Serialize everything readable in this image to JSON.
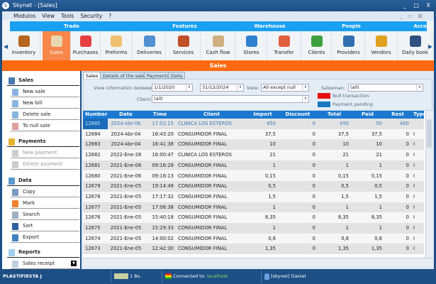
{
  "window": {
    "title": "Skynet - [Sales]"
  },
  "menu": [
    "Modulos",
    "View",
    "Tools",
    "Security",
    "?"
  ],
  "ribbon": {
    "groups": [
      "Trade",
      "Features",
      "Warehouse",
      "People",
      "Acco"
    ],
    "items": [
      {
        "label": "Inventory",
        "color": "#b5651d"
      },
      {
        "label": "Sales",
        "color": "#e8d7b0"
      },
      {
        "label": "Purchases",
        "color": "#e84040"
      },
      {
        "label": "Preforms",
        "color": "#f0c070"
      },
      {
        "label": "Deliveries",
        "color": "#5090d0"
      },
      {
        "label": "Services",
        "color": "#c0502a"
      },
      {
        "label": "Cash flow",
        "color": "#d0b080"
      },
      {
        "label": "Stores",
        "color": "#3080d0"
      },
      {
        "label": "Transfer",
        "color": "#e06040"
      },
      {
        "label": "Clients",
        "color": "#40a040"
      },
      {
        "label": "Providers",
        "color": "#3070b0"
      },
      {
        "label": "Vendors",
        "color": "#e0a020"
      },
      {
        "label": "Daily book",
        "color": "#305080"
      }
    ],
    "active": "Sales"
  },
  "section_title": "Sales",
  "left_panel": {
    "sales": {
      "title": "Sales",
      "items": [
        "New sale",
        "New bill",
        "Delete sale",
        "To null sale"
      ]
    },
    "payments": {
      "title": "Payments",
      "items": [
        "New payment",
        "Delete payment"
      ]
    },
    "data": {
      "title": "Data",
      "items": [
        "Copy",
        "Mark",
        "Search",
        "Sort",
        "Export"
      ]
    },
    "reports": {
      "title": "Reports",
      "items": [
        "Sales receipt"
      ]
    }
  },
  "tabs": [
    "Sales",
    "Details of the sale",
    "Payments",
    "Daily"
  ],
  "filters": {
    "between_label": "View information between:",
    "date_from": "1/1/2020",
    "date_to": "31/12/2024",
    "view_label": "View:",
    "view_value": "All except null",
    "salesman_label": "Salesman:",
    "salesman_value": "(all)",
    "client_label": "Client:",
    "client_value": "(all)"
  },
  "legend": [
    {
      "label": "Null transaction",
      "color": "#e81010"
    },
    {
      "label": "Payment pending",
      "color": "#1a78c0"
    }
  ],
  "table": {
    "columns": [
      "Number",
      "Date",
      "Time",
      "Client",
      "Import",
      "Discount",
      "Total",
      "Paid",
      "Rest",
      "Type"
    ],
    "rows": [
      [
        "12685",
        "2024-Abr-06",
        "17:02:15",
        "CLINICA LOS ESTEROS",
        "450",
        "0",
        "450",
        "50",
        "400",
        ""
      ],
      [
        "12684",
        "2024-Abr-04",
        "16:43:20",
        "CONSUMIDOR FINAL",
        "37,5",
        "0",
        "37,5",
        "37,5",
        "0",
        "I"
      ],
      [
        "12683",
        "2024-Abr-04",
        "16:41:38",
        "CONSUMIDOR FINAL",
        "10",
        "0",
        "10",
        "10",
        "0",
        "I"
      ],
      [
        "12682",
        "2022-Ene-28",
        "16:00:47",
        "CLINICA LOS ESTEROS",
        "21",
        "0",
        "21",
        "21",
        "0",
        "I"
      ],
      [
        "12681",
        "2021-Ene-06",
        "09:16:28",
        "CONSUMIDOR FINAL",
        "1",
        "0",
        "1",
        "1",
        "0",
        "I"
      ],
      [
        "12680",
        "2021-Ene-06",
        "09:16:13",
        "CONSUMIDOR FINAL",
        "0,15",
        "0",
        "0,15",
        "0,15",
        "0",
        "I"
      ],
      [
        "12679",
        "2021-Ene-05",
        "19:14:49",
        "CONSUMIDOR FINAL",
        "0,5",
        "0",
        "0,5",
        "0,5",
        "0",
        "I"
      ],
      [
        "12678",
        "2021-Ene-05",
        "17:17:32",
        "CONSUMIDOR FINAL",
        "1,5",
        "0",
        "1,5",
        "1,5",
        "0",
        "I"
      ],
      [
        "12677",
        "2021-Ene-05",
        "17:06:38",
        "CONSUMIDOR FINAL",
        "1",
        "0",
        "1",
        "1",
        "0",
        "I"
      ],
      [
        "12676",
        "2021-Ene-05",
        "15:40:18",
        "CONSUMIDOR FINAL",
        "8,35",
        "0",
        "8,35",
        "8,35",
        "0",
        "I"
      ],
      [
        "12675",
        "2021-Ene-05",
        "15:29:33",
        "CONSUMIDOR FINAL",
        "1",
        "0",
        "1",
        "1",
        "0",
        "I"
      ],
      [
        "12674",
        "2021-Ene-05",
        "14:00:02",
        "CONSUMIDOR FINAL",
        "0,8",
        "0",
        "0,8",
        "0,8",
        "0",
        "I"
      ],
      [
        "12673",
        "2021-Ene-05",
        "12:42:30",
        "CONSUMIDOR FINAL",
        "1,35",
        "0",
        "1,35",
        "1,35",
        "0",
        "I"
      ]
    ]
  },
  "status": {
    "company": "PLASTIFIESTA J",
    "rate": "1 Bs.",
    "connected_label": "Connected to:",
    "host": "localhost",
    "user": "[skynet] Daniel"
  }
}
